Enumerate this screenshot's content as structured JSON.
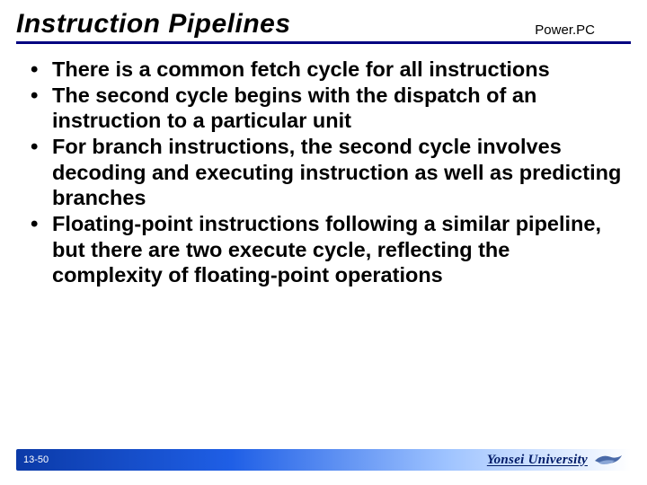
{
  "header": {
    "title": "Instruction Pipelines",
    "subtitle": "Power.PC"
  },
  "bullets": [
    "There is a common fetch cycle for all instructions",
    "The second cycle begins with the dispatch of an instruction to a particular unit",
    "For branch instructions, the second cycle involves decoding and executing instruction as well as predicting branches",
    "Floating-point instructions following a similar pipeline, but there are two execute cycle, reflecting the complexity of floating-point operations"
  ],
  "footer": {
    "slide_number": "13-50",
    "university": "Yonsei University"
  }
}
